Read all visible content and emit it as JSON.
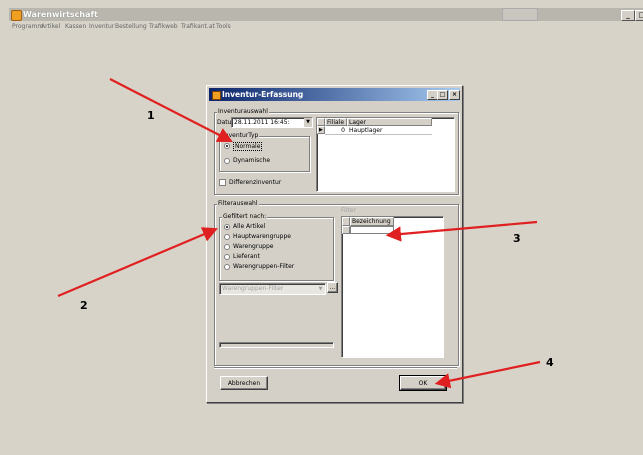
{
  "app": {
    "title": "Warenwirtschaft",
    "menu": [
      "Programm",
      "Artikel",
      "Kassen",
      "Inventur",
      "Bestellung",
      "Trafikweb",
      "Trafikant.at",
      "Tools"
    ],
    "window_buttons": {
      "minimize": "_",
      "maximize": "□"
    }
  },
  "dialog": {
    "title": "Inventur-Erfassung",
    "buttons": {
      "minimize": "_",
      "maximize": "□",
      "close": "×"
    },
    "inventurauswahl": {
      "legend": "Inventurauswahl",
      "datum_label": "Datum",
      "datum_value": "28.11.2011 16:45:",
      "inventurtyp_legend": "InventurTyp",
      "options": [
        {
          "label": "Normale",
          "selected": true
        },
        {
          "label": "Dynamische",
          "selected": false
        }
      ],
      "differenz_label": "Differenzinventur",
      "differenz_checked": false,
      "grid": {
        "columns": [
          "Filiale",
          "Lager"
        ],
        "rows": [
          {
            "filiale": "0",
            "lager": "Hauptlager"
          }
        ]
      }
    },
    "filterauswahl": {
      "legend": "Filterauswahl",
      "gefiltert_legend": "Gefiltert nach:",
      "options": [
        {
          "label": "Alle Artikel",
          "selected": true
        },
        {
          "label": "Hauptwarengruppe",
          "selected": false
        },
        {
          "label": "Warengruppe",
          "selected": false
        },
        {
          "label": "Lieferant",
          "selected": false
        },
        {
          "label": "Warengruppen-Filter",
          "selected": false
        }
      ],
      "dropdown_value": "Warengruppen-Filter",
      "browse_label": "...",
      "filter_label": "Filter",
      "filter_column": "Bezeichnung"
    },
    "cancel_label": "Abbrechen",
    "ok_label": "OK"
  },
  "annotations": [
    {
      "label": "1"
    },
    {
      "label": "2"
    },
    {
      "label": "3"
    },
    {
      "label": "4"
    }
  ],
  "colors": {
    "arrow": "#e02020",
    "titlebar_start": "#0a246a",
    "titlebar_end": "#a6caf0",
    "face": "#d4d0c8"
  }
}
